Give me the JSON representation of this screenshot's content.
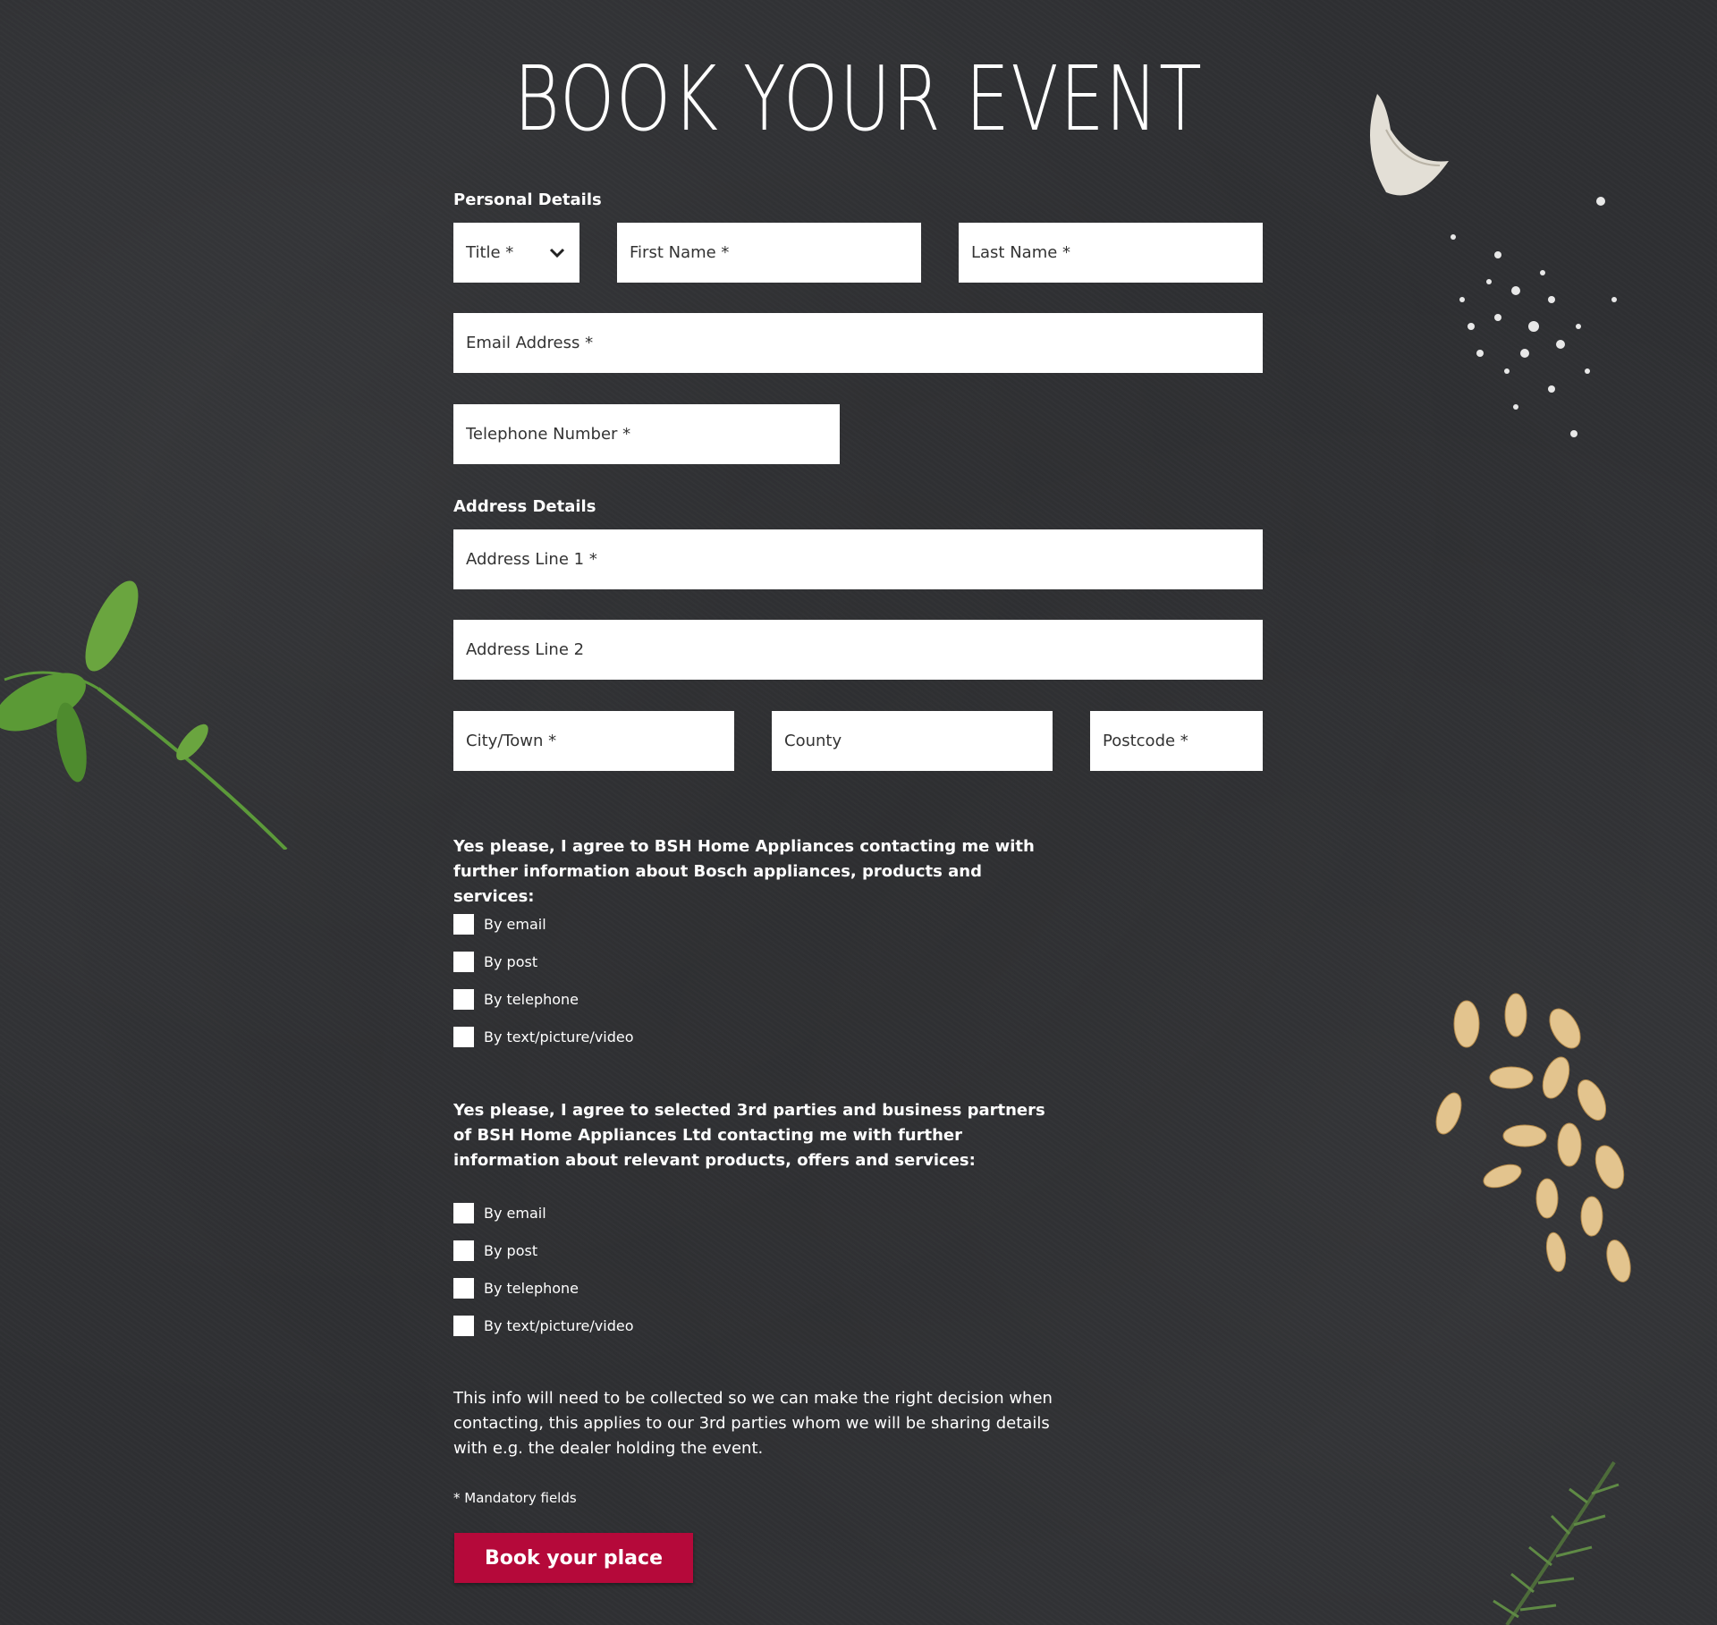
{
  "page": {
    "title": "BOOK YOUR EVENT"
  },
  "personal": {
    "label": "Personal Details",
    "title_select": "Title *",
    "first_name": "First Name *",
    "last_name": "Last Name *",
    "email": "Email Address *",
    "telephone": "Telephone Number *"
  },
  "address": {
    "label": "Address Details",
    "line1": "Address Line 1 *",
    "line2": "Address Line 2",
    "city": "City/Town *",
    "county": "County",
    "postcode": "Postcode *"
  },
  "consent_bsh": {
    "text": "Yes please, I agree to BSH Home Appliances contacting me with further information about Bosch appliances, products and services:",
    "options": [
      "By email",
      "By post",
      "By telephone",
      "By text/picture/video"
    ]
  },
  "consent_third": {
    "text": "Yes please, I agree to selected 3rd parties and business partners of BSH Home Appliances Ltd contacting me with further information about relevant products, offers and services:",
    "options": [
      "By email",
      "By post",
      "By telephone",
      "By text/picture/video"
    ]
  },
  "info_text": "This info will need to be collected so we can make the right decision when contacting, this applies to our 3rd parties whom we will be sharing details with e.g. the dealer holding the event.",
  "mandatory_note": "* Mandatory fields",
  "submit_label": "Book your place",
  "colors": {
    "button": "#b5093a",
    "background": "#2f3033"
  },
  "icons": [
    "chevron-down-icon",
    "basil-decoration",
    "garlic-decoration",
    "salt-decoration",
    "pine-nuts-decoration",
    "rosemary-decoration"
  ]
}
